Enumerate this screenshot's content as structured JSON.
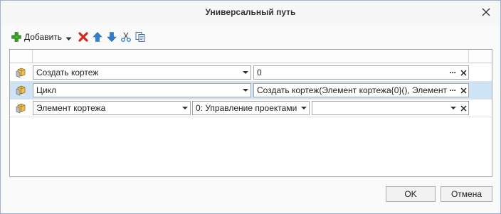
{
  "window": {
    "title": "Универсальный путь"
  },
  "toolbar": {
    "add_label": "Добавить",
    "icons": [
      "add-icon",
      "delete-icon",
      "move-up-icon",
      "move-down-icon",
      "cut-icon",
      "copy-icon"
    ]
  },
  "rows": [
    {
      "function": "Создать кортеж",
      "value": "0"
    },
    {
      "function": "Цикл",
      "value": "Создать кортеж(Элемент кортежа{0}(), Элемент"
    },
    {
      "function": "Элемент кортежа",
      "parameter": "0: Управление проектами",
      "value": ""
    }
  ],
  "buttons": {
    "ok": "OK",
    "cancel": "Отмена"
  },
  "colors": {
    "selected_row": "#cfe3f6",
    "add_green": "#3a9a2a",
    "delete_red": "#d9261c",
    "arrow_blue": "#2f7fd1"
  }
}
